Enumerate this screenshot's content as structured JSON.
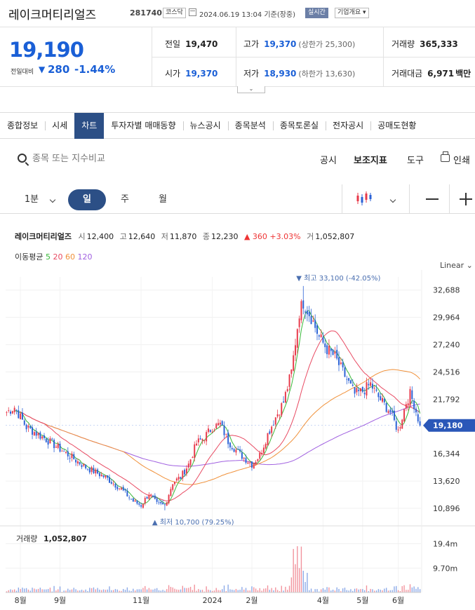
{
  "header": {
    "name": "레이크머티리얼즈",
    "code": "281740",
    "market": "코스닥",
    "datetime": "2024.06.19 13:04 기준(장중)",
    "live": "실시간",
    "info_dropdown": "기업개요 ▾"
  },
  "price": {
    "current": "19,190",
    "change_label": "전일대비",
    "change_arrow": "▼",
    "change": "280",
    "change_pct": "-1.44%",
    "prev_close_label": "전일",
    "prev_close": "19,470",
    "high_label": "고가",
    "high": "19,370",
    "upper_limit": "(상한가 25,300)",
    "volume_label": "거래량",
    "volume": "365,333",
    "open_label": "시가",
    "open": "19,370",
    "low_label": "저가",
    "low": "18,930",
    "lower_limit": "(하한가 13,630)",
    "value_label": "거래대금",
    "value": "6,971",
    "value_unit": "백만",
    "expander": "⌄"
  },
  "tabs": [
    "종합정보",
    "시세",
    "차트",
    "투자자별 매매동향",
    "뉴스공시",
    "종목분석",
    "종목토론실",
    "전자공시",
    "공매도현황"
  ],
  "active_tab": "차트",
  "toolbar": {
    "search_placeholder": "종목 또는 지수비교",
    "disclosure": "공시",
    "indicators": "보조지표",
    "tools": "도구",
    "print": "인쇄"
  },
  "periods": {
    "minute": "1분",
    "day": "일",
    "week": "주",
    "month": "월"
  },
  "legend": {
    "name": "레이크머티리얼즈",
    "open_k": "시",
    "open": "12,400",
    "high_k": "고",
    "high": "12,640",
    "low_k": "저",
    "low": "11,870",
    "close_k": "종",
    "close": "12,230",
    "change": "▲ 360 +3.03%",
    "vol_k": "거",
    "vol": "1,052,807",
    "ma_label": "이동평균",
    "ma5": "5",
    "ma20": "20",
    "ma60": "60",
    "ma120": "120",
    "scale_mode": "Linear ⌄"
  },
  "colors": {
    "up": "#e8394a",
    "down": "#2b62d6",
    "ma5": "#38b838",
    "ma20": "#e84a62",
    "ma60": "#f0913a",
    "ma120": "#a060e0",
    "accent": "#2c4f86"
  },
  "chart_data": {
    "type": "candlestick",
    "y_ticks": [
      32688,
      29964,
      27240,
      24516,
      21792,
      16344,
      13620,
      10896
    ],
    "y_tick_labels": [
      "32,688",
      "29,964",
      "27,240",
      "24,516",
      "21,792",
      "16,344",
      "13,620",
      "10,896"
    ],
    "ylim": [
      9500,
      34000
    ],
    "x_labels": [
      "8월",
      "9월",
      "11월",
      "2024",
      "2월",
      "4월",
      "5월",
      "6월"
    ],
    "x_label_positions": [
      7,
      27,
      68,
      104,
      124,
      160,
      180,
      198
    ],
    "n_days": 210,
    "current_price": 19180,
    "current_price_label": "19,180",
    "high_annotation": "▼ 최고 33,100 (-42.05%)",
    "high_value": 33100,
    "low_annotation": "▲ 최저 10,700 (79.25%)",
    "low_value": 10700,
    "close_anchors": [
      [
        0,
        20500
      ],
      [
        4,
        21000
      ],
      [
        10,
        19000
      ],
      [
        20,
        17800
      ],
      [
        30,
        16400
      ],
      [
        40,
        15000
      ],
      [
        50,
        14000
      ],
      [
        58,
        12800
      ],
      [
        64,
        11600
      ],
      [
        68,
        11200
      ],
      [
        72,
        12400
      ],
      [
        76,
        11300
      ],
      [
        80,
        11200
      ],
      [
        84,
        13500
      ],
      [
        88,
        14000
      ],
      [
        92,
        15300
      ],
      [
        96,
        17400
      ],
      [
        100,
        18000
      ],
      [
        104,
        19000
      ],
      [
        108,
        19300
      ],
      [
        112,
        17600
      ],
      [
        118,
        16300
      ],
      [
        124,
        15300
      ],
      [
        128,
        16200
      ],
      [
        132,
        18300
      ],
      [
        136,
        20000
      ],
      [
        140,
        21500
      ],
      [
        144,
        24500
      ],
      [
        148,
        30500
      ],
      [
        150,
        31500
      ],
      [
        154,
        30000
      ],
      [
        158,
        28000
      ],
      [
        162,
        26800
      ],
      [
        166,
        26000
      ],
      [
        170,
        24500
      ],
      [
        176,
        22300
      ],
      [
        180,
        22600
      ],
      [
        184,
        23300
      ],
      [
        188,
        22000
      ],
      [
        194,
        20500
      ],
      [
        198,
        18600
      ],
      [
        202,
        21500
      ],
      [
        204,
        22300
      ],
      [
        206,
        21300
      ],
      [
        209,
        19180
      ]
    ],
    "volume": {
      "label": "거래량",
      "value": "1,052,807",
      "tick_labels": [
        "19.4m",
        "9.70m"
      ],
      "ticks": [
        19400000,
        9700000
      ]
    }
  }
}
